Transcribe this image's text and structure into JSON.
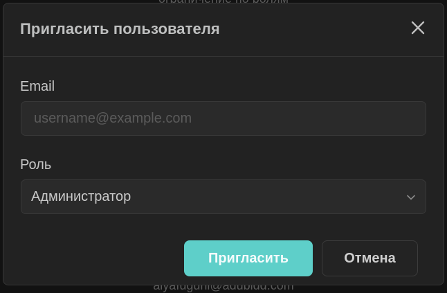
{
  "backdrop": {
    "top_text": "ограничение по ролям",
    "bottom_text": "aiyafuguhi@adubidd.com"
  },
  "modal": {
    "title": "Пригласить пользователя",
    "close_icon": "close-icon"
  },
  "form": {
    "email_label": "Email",
    "email_value": "",
    "email_placeholder": "username@example.com",
    "role_label": "Роль",
    "role_value": "Администратор",
    "role_icon": "chevron-down-icon"
  },
  "actions": {
    "invite_label": "Пригласить",
    "cancel_label": "Отмена"
  },
  "colors": {
    "accent": "#5ecfc9",
    "modal_bg": "#222222",
    "input_bg": "#2a2a2a"
  }
}
